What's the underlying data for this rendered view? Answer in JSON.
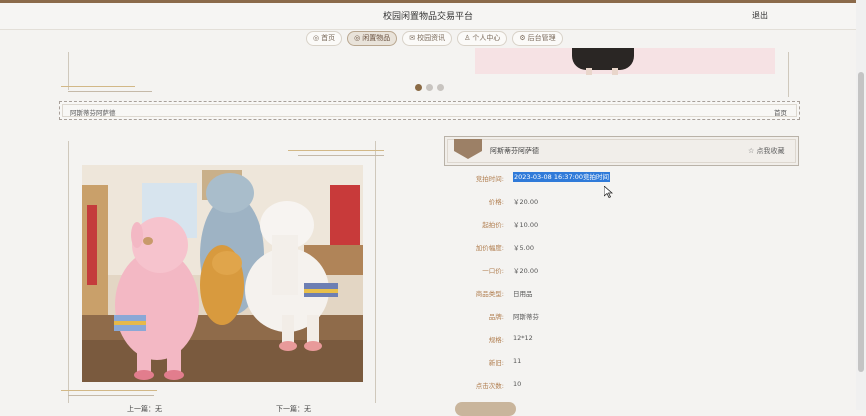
{
  "header": {
    "site_title": "校园闲置物品交易平台",
    "logout_label": "退出"
  },
  "nav": [
    {
      "icon": "home-icon",
      "glyph": "◎",
      "label": "首页"
    },
    {
      "icon": "goods-icon",
      "glyph": "◎",
      "label": "闲置物品"
    },
    {
      "icon": "news-icon",
      "glyph": "✉",
      "label": "校园资讯"
    },
    {
      "icon": "user-icon",
      "glyph": "♙",
      "label": "个人中心"
    },
    {
      "icon": "admin-icon",
      "glyph": "⚙",
      "label": "后台管理"
    }
  ],
  "carousel": {
    "dot_count": 3,
    "active_dot": 1
  },
  "breadcrumb": {
    "current": "阿斯蒂芬阿萨德",
    "home": "首页"
  },
  "product": {
    "title": "阿斯蒂芬阿萨德",
    "favorite_label": "☆ 点我收藏",
    "fields": [
      {
        "label": "竞拍时间:",
        "value": "2023-03-08 16:37:00竞拍时间",
        "selected": true
      },
      {
        "label": "价格:",
        "value": "￥20.00"
      },
      {
        "label": "起拍价:",
        "value": "￥10.00"
      },
      {
        "label": "加价幅度:",
        "value": "￥5.00"
      },
      {
        "label": "一口价:",
        "value": "￥20.00"
      },
      {
        "label": "商品类型:",
        "value": "日用品"
      },
      {
        "label": "品牌:",
        "value": "阿斯蒂芬"
      },
      {
        "label": "规格:",
        "value": "12*12"
      },
      {
        "label": "新旧:",
        "value": "11"
      },
      {
        "label": "点击次数:",
        "value": "10"
      }
    ]
  },
  "pager": {
    "prev": "上一篇：无",
    "next": "下一篇：无"
  },
  "colors": {
    "accent": "#8b6a4a",
    "label": "#b07d4e",
    "selection": "#2f7ad9"
  }
}
